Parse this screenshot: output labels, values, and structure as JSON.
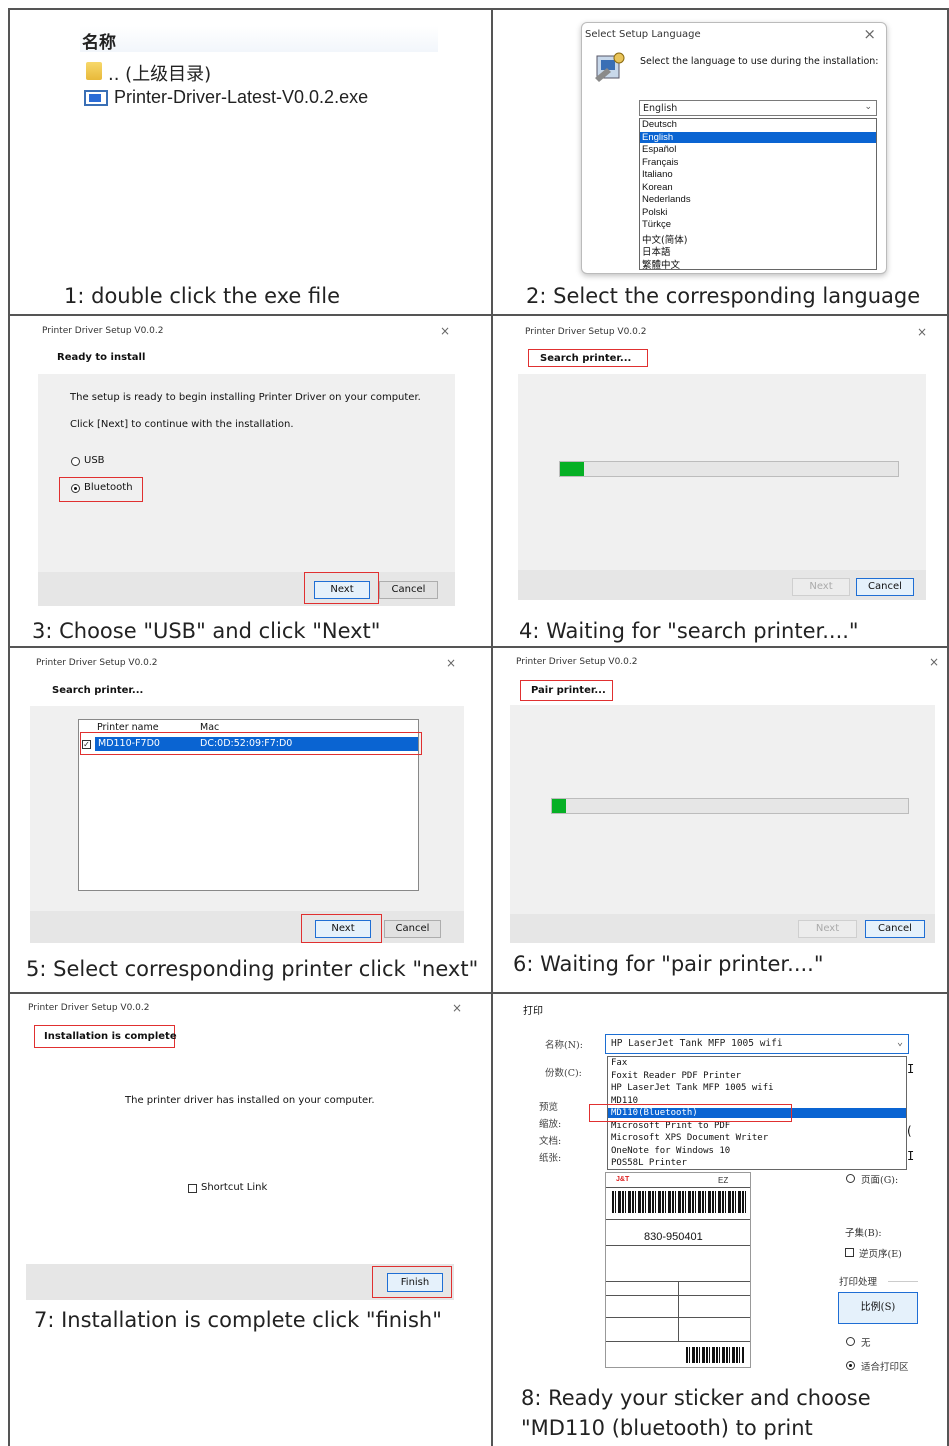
{
  "steps": [
    {
      "caption": "1: double click the exe file"
    },
    {
      "caption": "2: Select the corresponding language"
    },
    {
      "caption": "3: Choose \"USB\" and click \"Next\""
    },
    {
      "caption": "4: Waiting for \"search printer....\""
    },
    {
      "caption": "5: Select corresponding printer click \"next\""
    },
    {
      "caption": "6: Waiting for \"pair printer....\""
    },
    {
      "caption": "7: Installation is complete click \"finish\""
    },
    {
      "caption_line1": "8: Ready your sticker and choose",
      "caption_line2": "\"MD110 (bluetooth) to print"
    }
  ],
  "explorer": {
    "header": "名称",
    "parent_dir": ".. (上级目录)",
    "file_name": "Printer-Driver-Latest-V0.0.2.exe"
  },
  "language_dialog": {
    "title": "Select Setup Language",
    "prompt": "Select the language to use during the installation:",
    "selected": "English",
    "options": [
      "Deutsch",
      "English",
      "Español",
      "Français",
      "Italiano",
      "Korean",
      "Nederlands",
      "Polski",
      "Türkçe",
      "中文(简体)",
      "日本語",
      "繁體中文"
    ],
    "highlighted_index": 1
  },
  "setup": {
    "window_title": "Printer Driver Setup V0.0.2",
    "close_glyph": "×",
    "next": "Next",
    "cancel": "Cancel",
    "finish": "Finish"
  },
  "ready": {
    "title": "Ready to install",
    "line1": "The setup is ready to begin installing Printer Driver on your computer.",
    "line2": "Click [Next] to continue with the installation.",
    "option_usb": "USB",
    "option_bluetooth": "Bluetooth",
    "selected_option": "Bluetooth"
  },
  "search": {
    "title": "Search printer...",
    "progress": 0.07
  },
  "select": {
    "title": "Search printer...",
    "col_name": "Printer name",
    "col_mac": "Mac",
    "rows": [
      {
        "name": "MD110-F7D0",
        "mac": "DC:0D:52:09:F7:D0",
        "checked": true
      }
    ]
  },
  "pair": {
    "title": "Pair printer...",
    "progress": 0.04
  },
  "complete": {
    "title": "Installation is complete",
    "message": "The printer driver has installed on your computer.",
    "shortcut": "Shortcut Link"
  },
  "print_dialog": {
    "title": "打印",
    "name_label": "名称(N):",
    "copies_label": "份数(C):",
    "preview_label": "预览",
    "zoom_label": "缩放:",
    "doc_label": "文档:",
    "paper_label": "纸张:",
    "selected_printer": "HP LaserJet Tank MFP 1005 wifi",
    "printers": [
      "Fax",
      "Foxit Reader PDF Printer",
      "HP LaserJet Tank MFP 1005 wifi",
      "MD110",
      "MD110(Bluetooth)",
      "Microsoft Print to PDF",
      "Microsoft XPS Document Writer",
      "OneNote for Windows 10",
      "POS58L Printer"
    ],
    "highlighted_index": 4,
    "pages_option": "页面(G):",
    "subset_label": "子集(B):",
    "reverse_label": "逆页序(E)",
    "handling_label": "打印处理",
    "scale_button": "比例(S)",
    "none_option": "无",
    "fit_option": "适合打印区",
    "partial_glyph_1": "I",
    "partial_glyph_2": "(",
    "partial_glyph_3": "I",
    "label_brand": "J&T",
    "label_code": "EZ",
    "label_number": "830-950401"
  },
  "colors": {
    "highlight_red": "#e03030",
    "selection_blue": "#0a64d2",
    "progress_green": "#06b025"
  }
}
